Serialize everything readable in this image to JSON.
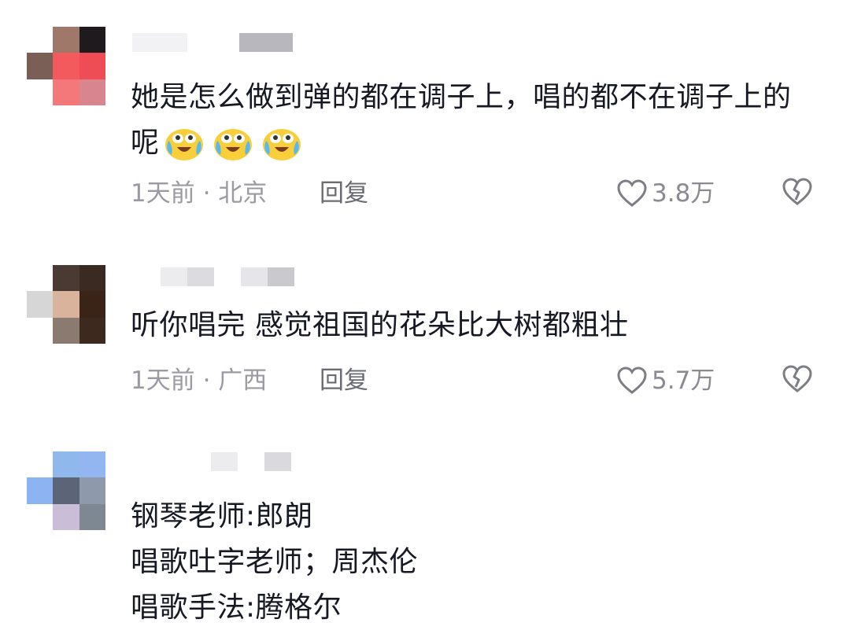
{
  "comments": [
    {
      "text": "她是怎么做到弹的都在调子上，唱的都不在调子上的呢",
      "emojis": [
        "crying-laughing-emoji",
        "crying-laughing-emoji",
        "crying-laughing-emoji"
      ],
      "time_location": "1天前 · 北京",
      "reply_label": "回复",
      "likes": "3.8万",
      "like_icon": "heart-outline-icon",
      "dislike_icon": "broken-heart-icon"
    },
    {
      "text": "听你唱完 感觉祖国的花朵比大树都粗壮",
      "time_location": "1天前 · 广西",
      "reply_label": "回复",
      "likes": "5.7万",
      "like_icon": "heart-outline-icon",
      "dislike_icon": "broken-heart-icon"
    },
    {
      "lines": [
        "钢琴老师:郎朗",
        "唱歌吐字老师；周杰伦",
        "唱歌手法:腾格尔"
      ]
    }
  ],
  "colors": {
    "text": "#161823",
    "meta": "#9a9aa3",
    "reply": "#6b6c73",
    "icon": "#7d7e85"
  }
}
